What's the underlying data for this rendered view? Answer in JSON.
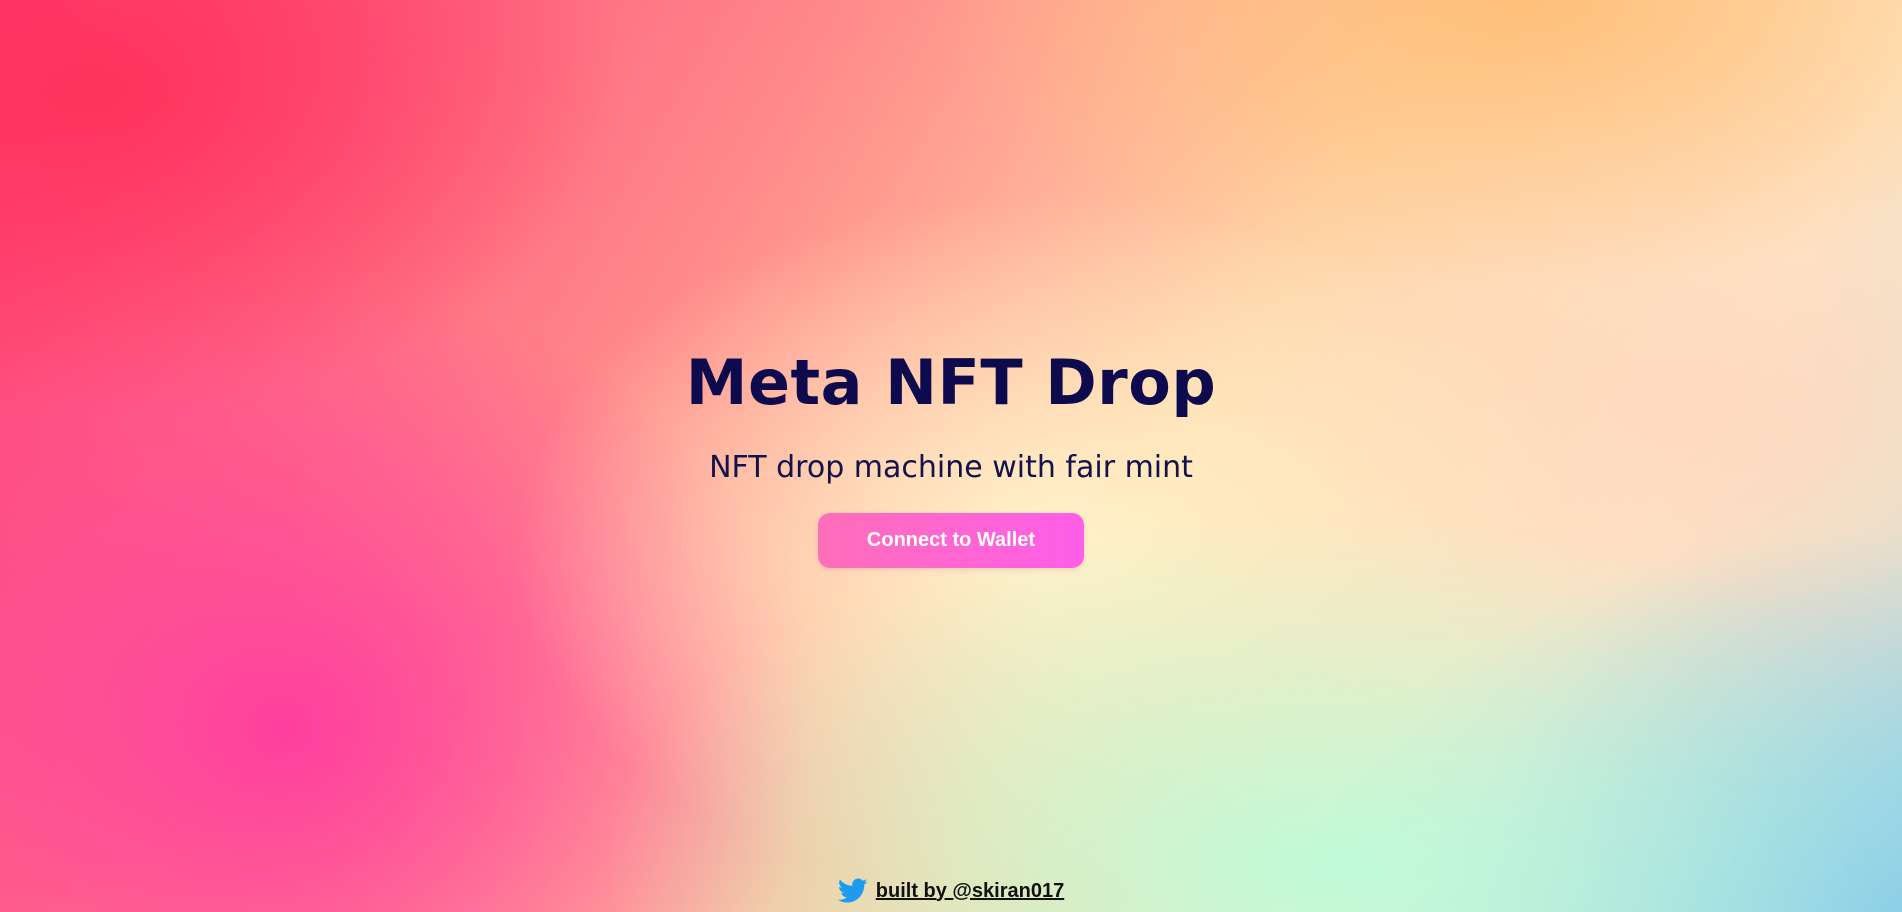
{
  "hero": {
    "title": "Meta NFT Drop",
    "subtitle": "NFT drop machine with fair mint",
    "connect_button_label": "Connect to Wallet"
  },
  "footer": {
    "icon": "twitter-icon",
    "link_text": "built by @skiran017"
  },
  "colors": {
    "title": "#0d0a4e",
    "button_start": "#ff6eb8",
    "button_end": "#ff5ee8",
    "twitter_blue": "#1d9bf0"
  }
}
